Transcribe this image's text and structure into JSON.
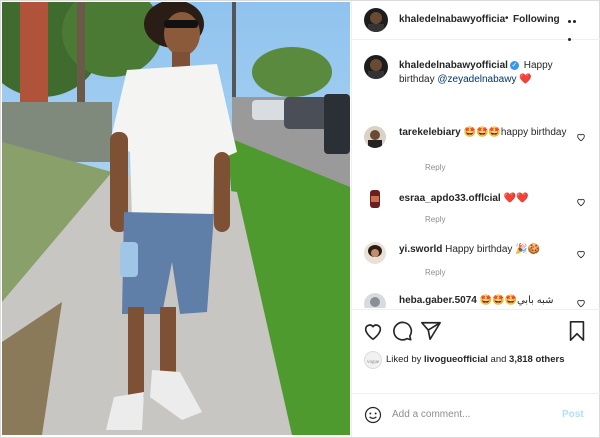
{
  "post": {
    "username": "khaledelnabawyofficia",
    "separator": "•",
    "follow_label": "Following"
  },
  "caption": {
    "username": "khaledelnabawyofficial",
    "text": "Happy birthday",
    "mention": "@zeyadelnabawy",
    "emoji": "❤️"
  },
  "comments": [
    {
      "username": "tarekelebiary",
      "emoji": "🤩🤩🤩",
      "text": "happy birthday",
      "reply": "Reply"
    },
    {
      "username": "esraa_apdo33.offlcial",
      "emoji": "❤️❤️",
      "text": "",
      "reply": "Reply"
    },
    {
      "username": "yi.sworld",
      "emoji": "",
      "text": "Happy birthday 🎉🍪",
      "reply": "Reply"
    },
    {
      "username": "heba.gaber.5074",
      "emoji": "🤩🤩🤩",
      "text": "شبه بابي",
      "reply": ""
    }
  ],
  "likes": {
    "prefix": "Liked by",
    "user": "livogueofficial",
    "middle": "and",
    "count": "3,818 others"
  },
  "add_comment": {
    "placeholder": "Add a comment...",
    "post_label": "Post"
  },
  "colors": {
    "verified": "#3897f0",
    "heart": "#ed4956",
    "post_disabled": "#b2dffc"
  },
  "icons": [
    "heart-icon",
    "comment-icon",
    "share-icon",
    "bookmark-icon",
    "emoji-icon",
    "more-options-icon"
  ]
}
